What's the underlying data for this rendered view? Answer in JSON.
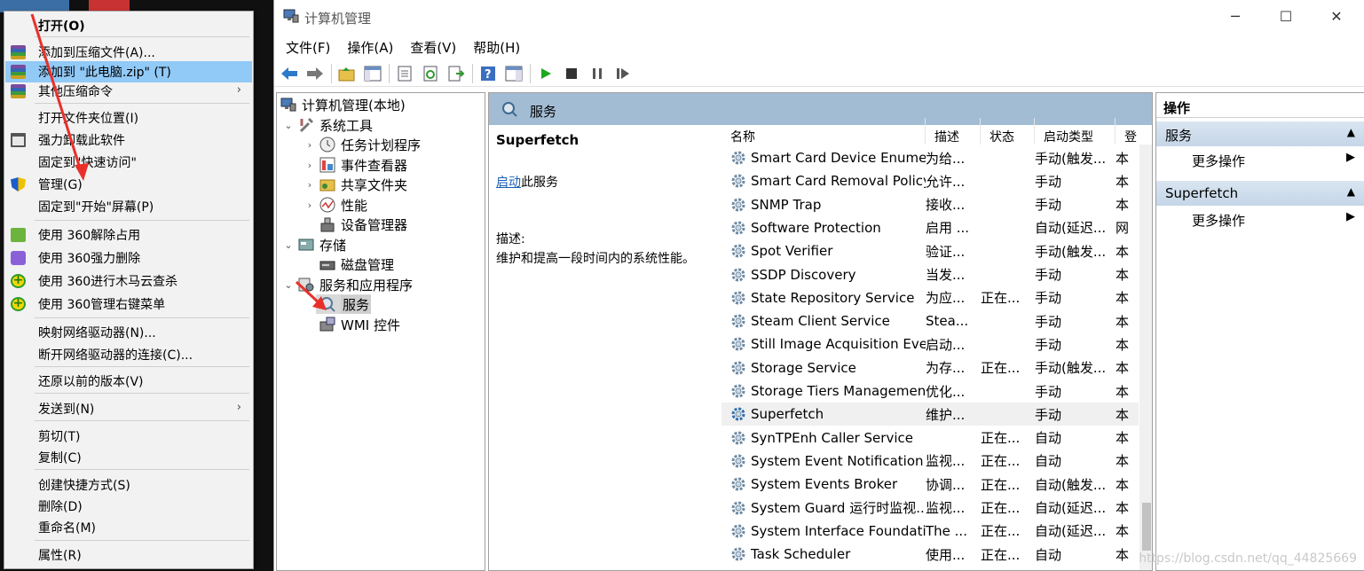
{
  "context_menu": {
    "items": [
      {
        "label": "打开(O)",
        "icon": "",
        "bold": true
      },
      {
        "label": "添加到压缩文件(A)...",
        "icon": "winrar-icon"
      },
      {
        "label": "添加到 \"此电脑.zip\" (T)",
        "icon": "winrar-icon",
        "highlighted": true
      },
      {
        "label": "其他压缩命令",
        "icon": "winrar-icon",
        "submenu": true
      },
      {
        "label": "打开文件夹位置(I)",
        "icon": ""
      },
      {
        "label": "强力卸载此软件",
        "icon": "trash-icon"
      },
      {
        "label": "固定到\"快速访问\"",
        "icon": ""
      },
      {
        "label": "管理(G)",
        "icon": "shield-icon"
      },
      {
        "label": "固定到\"开始\"屏幕(P)",
        "icon": ""
      },
      {
        "label": "使用 360解除占用",
        "icon": "360-unlock-icon"
      },
      {
        "label": "使用 360强力删除",
        "icon": "360-delete-icon"
      },
      {
        "label": "使用 360进行木马云查杀",
        "icon": "360-scan-icon"
      },
      {
        "label": "使用 360管理右键菜单",
        "icon": "360-menu-icon"
      },
      {
        "label": "映射网络驱动器(N)...",
        "icon": ""
      },
      {
        "label": "断开网络驱动器的连接(C)...",
        "icon": ""
      },
      {
        "label": "还原以前的版本(V)",
        "icon": ""
      },
      {
        "label": "发送到(N)",
        "icon": "",
        "submenu": true
      },
      {
        "label": "剪切(T)",
        "icon": ""
      },
      {
        "label": "复制(C)",
        "icon": ""
      },
      {
        "label": "创建快捷方式(S)",
        "icon": ""
      },
      {
        "label": "删除(D)",
        "icon": ""
      },
      {
        "label": "重命名(M)",
        "icon": ""
      },
      {
        "label": "属性(R)",
        "icon": ""
      }
    ],
    "submenu_arrow": "›"
  },
  "window": {
    "title": "计算机管理",
    "controls": {
      "minimize": "─",
      "maximize": "☐",
      "close": "✕"
    },
    "menu": [
      "文件(F)",
      "操作(A)",
      "查看(V)",
      "帮助(H)"
    ]
  },
  "tree": {
    "root": "计算机管理(本地)",
    "system_tools": "系统工具",
    "task_scheduler": "任务计划程序",
    "event_viewer": "事件查看器",
    "shared_folders": "共享文件夹",
    "performance": "性能",
    "device_manager": "设备管理器",
    "storage": "存储",
    "disk_management": "磁盘管理",
    "services_apps": "服务和应用程序",
    "services": "服务",
    "wmi": "WMI 控件",
    "expanded": "⌄",
    "collapsed": "›"
  },
  "center": {
    "header": "服务",
    "selected_service": "Superfetch",
    "start_link": "启动",
    "start_suffix": "此服务",
    "desc_label": "描述:",
    "desc_text": "维护和提高一段时间内的系统性能。",
    "columns": [
      "名称",
      "描述",
      "状态",
      "启动类型",
      "登"
    ],
    "services": [
      {
        "name": "Smart Card Device Enumer...",
        "desc": "为给...",
        "state": "",
        "startup": "手动(触发...",
        "login": "本"
      },
      {
        "name": "Smart Card Removal Policy",
        "desc": "允许...",
        "state": "",
        "startup": "手动",
        "login": "本"
      },
      {
        "name": "SNMP Trap",
        "desc": "接收...",
        "state": "",
        "startup": "手动",
        "login": "本"
      },
      {
        "name": "Software Protection",
        "desc": "启用 ...",
        "state": "",
        "startup": "自动(延迟...",
        "login": "网"
      },
      {
        "name": "Spot Verifier",
        "desc": "验证...",
        "state": "",
        "startup": "手动(触发...",
        "login": "本"
      },
      {
        "name": "SSDP Discovery",
        "desc": "当发...",
        "state": "",
        "startup": "手动",
        "login": "本"
      },
      {
        "name": "State Repository Service",
        "desc": "为应...",
        "state": "正在...",
        "startup": "手动",
        "login": "本"
      },
      {
        "name": "Steam Client Service",
        "desc": "Stea...",
        "state": "",
        "startup": "手动",
        "login": "本"
      },
      {
        "name": "Still Image Acquisition Eve...",
        "desc": "启动...",
        "state": "",
        "startup": "手动",
        "login": "本"
      },
      {
        "name": "Storage Service",
        "desc": "为存...",
        "state": "正在...",
        "startup": "手动(触发...",
        "login": "本"
      },
      {
        "name": "Storage Tiers Management",
        "desc": "优化...",
        "state": "",
        "startup": "手动",
        "login": "本"
      },
      {
        "name": "Superfetch",
        "desc": "维护...",
        "state": "",
        "startup": "手动",
        "login": "本",
        "selected": true
      },
      {
        "name": "SynTPEnh Caller Service",
        "desc": "",
        "state": "正在...",
        "startup": "自动",
        "login": "本"
      },
      {
        "name": "System Event Notification ...",
        "desc": "监视...",
        "state": "正在...",
        "startup": "自动",
        "login": "本"
      },
      {
        "name": "System Events Broker",
        "desc": "协调...",
        "state": "正在...",
        "startup": "自动(触发...",
        "login": "本"
      },
      {
        "name": "System Guard 运行时监视...",
        "desc": "监视...",
        "state": "正在...",
        "startup": "自动(延迟...",
        "login": "本"
      },
      {
        "name": "System Interface Foundati...",
        "desc": "The ...",
        "state": "正在...",
        "startup": "自动(延迟...",
        "login": "本"
      },
      {
        "name": "Task Scheduler",
        "desc": "使用...",
        "state": "正在...",
        "startup": "自动",
        "login": "本"
      }
    ]
  },
  "actions": {
    "header": "操作",
    "section1": "服务",
    "more1": "更多操作",
    "section2": "Superfetch",
    "more2": "更多操作",
    "collapse_glyph": "▲",
    "more_glyph": "▶"
  },
  "watermark": "https://blog.csdn.net/qq_44825669",
  "accent_colors": {
    "highlight": "#91c9f7",
    "panel_header": "#a2bcd4",
    "annotation": "#e8302a"
  }
}
